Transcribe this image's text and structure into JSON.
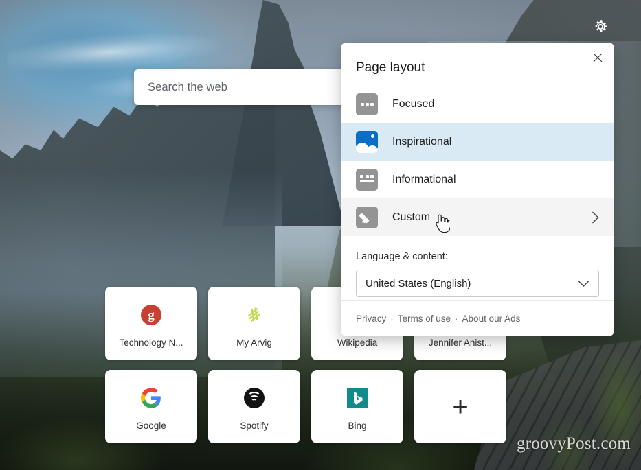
{
  "background": {
    "description": "misty mountain cliff landscape",
    "watermark": "groovyPost.com"
  },
  "topbar": {
    "settings_icon": "gear-icon"
  },
  "search": {
    "placeholder": "Search the web",
    "value": ""
  },
  "tiles": [
    [
      {
        "label": "Technology N...",
        "icon": "technology-news-icon"
      },
      {
        "label": "My Arvig",
        "icon": "arvig-icon"
      },
      {
        "label": "Wikipedia",
        "icon": "wikipedia-icon"
      },
      {
        "label": "Jennifer Anist...",
        "icon": "jennifer-aniston-icon"
      }
    ],
    [
      {
        "label": "Google",
        "icon": "google-icon"
      },
      {
        "label": "Spotify",
        "icon": "spotify-icon"
      },
      {
        "label": "Bing",
        "icon": "bing-icon"
      },
      {
        "label": "",
        "icon": "plus-icon"
      }
    ]
  ],
  "add_tile": {
    "glyph": "+"
  },
  "panel": {
    "title": "Page layout",
    "close_icon": "close-icon",
    "options": [
      {
        "label": "Focused",
        "icon": "focused-layout-icon",
        "state": "normal",
        "chevron": false
      },
      {
        "label": "Inspirational",
        "icon": "inspirational-layout-icon",
        "state": "selected",
        "chevron": false
      },
      {
        "label": "Informational",
        "icon": "informational-layout-icon",
        "state": "normal",
        "chevron": false
      },
      {
        "label": "Custom",
        "icon": "custom-layout-icon",
        "state": "hover",
        "chevron": true
      }
    ],
    "language": {
      "label": "Language & content:",
      "value": "United States (English)",
      "chevron_icon": "chevron-down-icon"
    },
    "footer": {
      "links": [
        "Privacy",
        "Terms of use",
        "About our Ads"
      ],
      "separator": "·"
    }
  },
  "colors": {
    "selected_row": "#d9eaf5",
    "hover_row": "#f4f4f4",
    "accent_blue": "#0a6ec4",
    "icon_gray": "#949494",
    "panel_bg": "#ffffff"
  }
}
